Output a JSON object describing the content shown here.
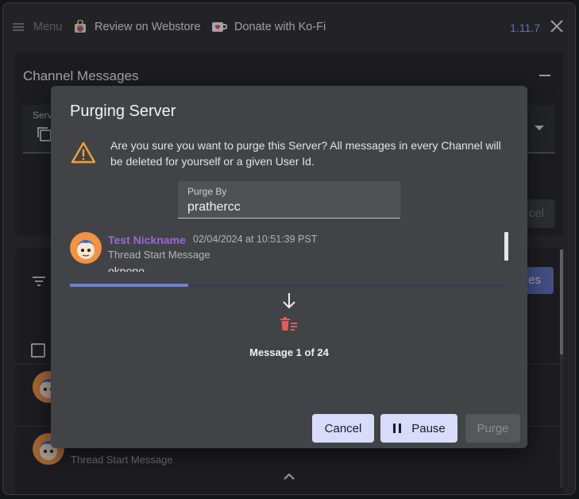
{
  "topbar": {
    "menu_label": "Menu",
    "review_label": "Review on Webstore",
    "donate_label": "Donate with Ko-Fi",
    "version": "1.11.7"
  },
  "background": {
    "section_title": "Channel Messages",
    "server_field_label_partial": "Serv",
    "cancel_partial": "cel",
    "filter_button_partial": "es",
    "row_subtitle": "Thread Start Message"
  },
  "dialog": {
    "title": "Purging Server",
    "warning_text": "Are you sure you want to purge this Server? All messages in every Channel will be deleted for yourself or a given User Id.",
    "purge_by_label": "Purge By",
    "purge_by_value": "prathercc",
    "message": {
      "nickname": "Test Nickname",
      "timestamp": "02/04/2024 at 10:51:39 PST",
      "subtitle": "Thread Start Message",
      "content_partial": "okpono"
    },
    "progress_fraction": 0.27,
    "counter": "Message 1 of 24",
    "cancel_label": "Cancel",
    "pause_label": "Pause",
    "purge_label": "Purge"
  },
  "colors": {
    "accent": "#6b80d6",
    "nickname": "#9b6ad0",
    "warning": "#f0a13a",
    "delete": "#e55a5a"
  },
  "icons": [
    "menu-icon",
    "webstore-icon",
    "kofi-cup-icon",
    "close-icon",
    "minimize-icon",
    "warning-icon",
    "down-arrow-icon",
    "trash-queue-icon",
    "pause-icon",
    "filter-icon",
    "checkbox-icon",
    "chevron-up-icon",
    "copy-icon",
    "dropdown-icon"
  ]
}
